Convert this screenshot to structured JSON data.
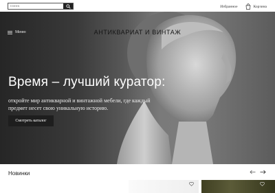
{
  "header": {
    "search_placeholder": "Поиск",
    "brand": "АНТИКВАРИАТ И ВИНТАЖ",
    "favorites": "Избранное",
    "cart": "Корзина",
    "menu": "Меню"
  },
  "hero": {
    "title": "Время – лучший куратор:",
    "text": "откройте мир антикварной и винтажной мебели, где каждый предмет несет свою уникальную историю.",
    "button": "Смотреть каталог"
  },
  "news": {
    "title": "Новинки"
  },
  "icons": [
    "search-icon",
    "cart-icon",
    "menu-icon",
    "arrow-left-icon",
    "arrow-right-icon",
    "heart-icon"
  ],
  "colors": {
    "button_bg": "#1e1e1e",
    "hero_text": "#ffffff"
  }
}
